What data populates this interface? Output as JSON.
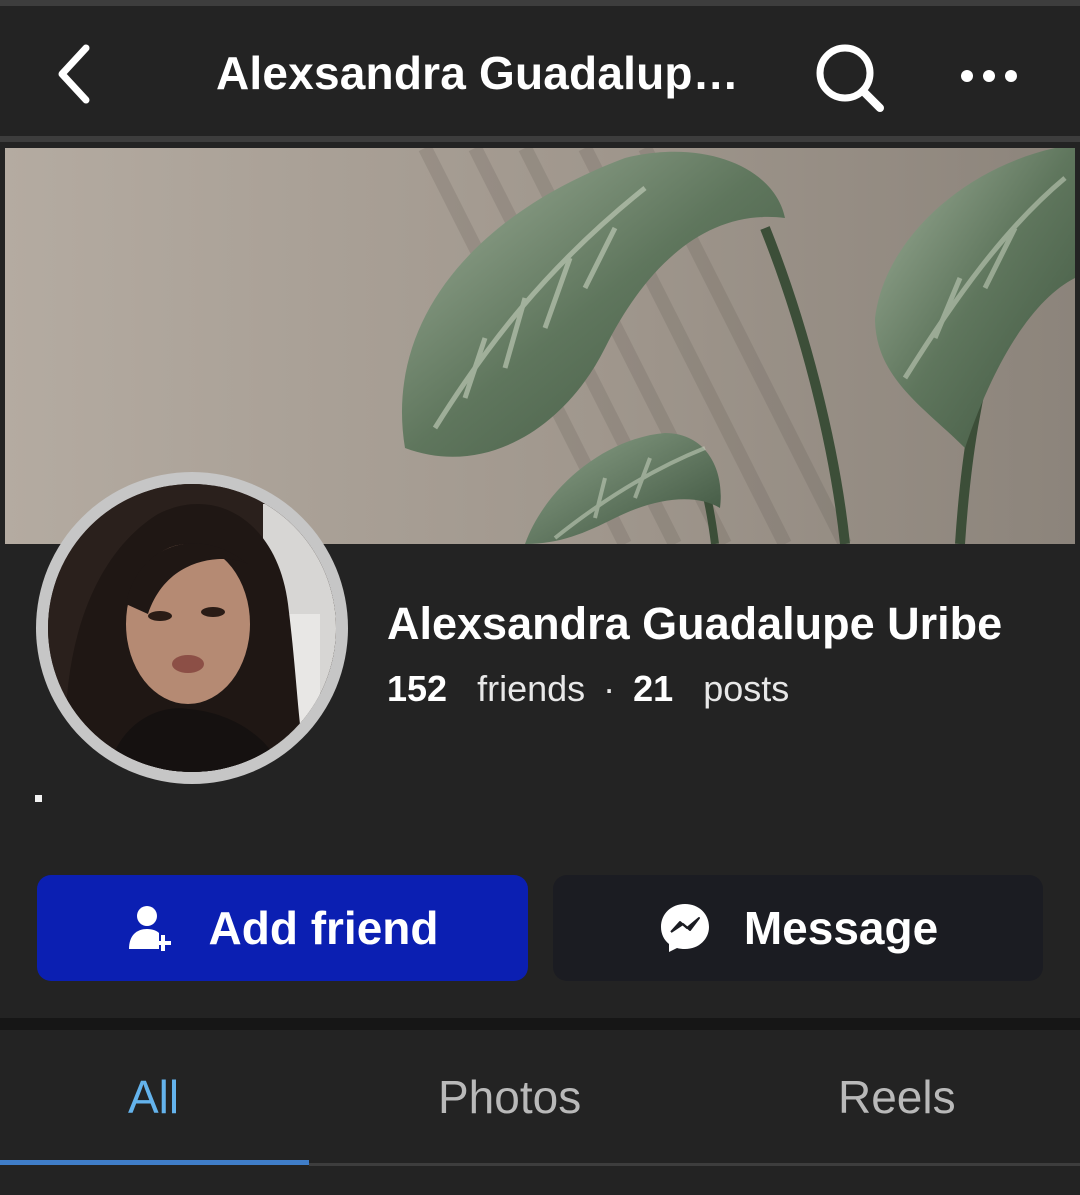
{
  "appbar": {
    "title": "Alexsandra Guadalupe ...",
    "back_icon": "chevron-left-icon",
    "search_icon": "search-icon",
    "more_icon": "more-horizontal-icon"
  },
  "profile": {
    "name": "Alexsandra Guadalupe Uribe",
    "friends_count": "152",
    "friends_label": "friends",
    "separator": "·",
    "posts_count": "21",
    "posts_label": "posts"
  },
  "actions": {
    "add_friend_label": "Add friend",
    "add_friend_icon": "add-person-icon",
    "message_label": "Message",
    "message_icon": "messenger-icon"
  },
  "tabs": [
    {
      "label": "All",
      "selected": true
    },
    {
      "label": "Photos",
      "selected": false
    },
    {
      "label": "Reels",
      "selected": false
    }
  ],
  "colors": {
    "primary_button": "#0b1fb2",
    "selected_tab": "#64b3ec",
    "background": "#232323"
  }
}
